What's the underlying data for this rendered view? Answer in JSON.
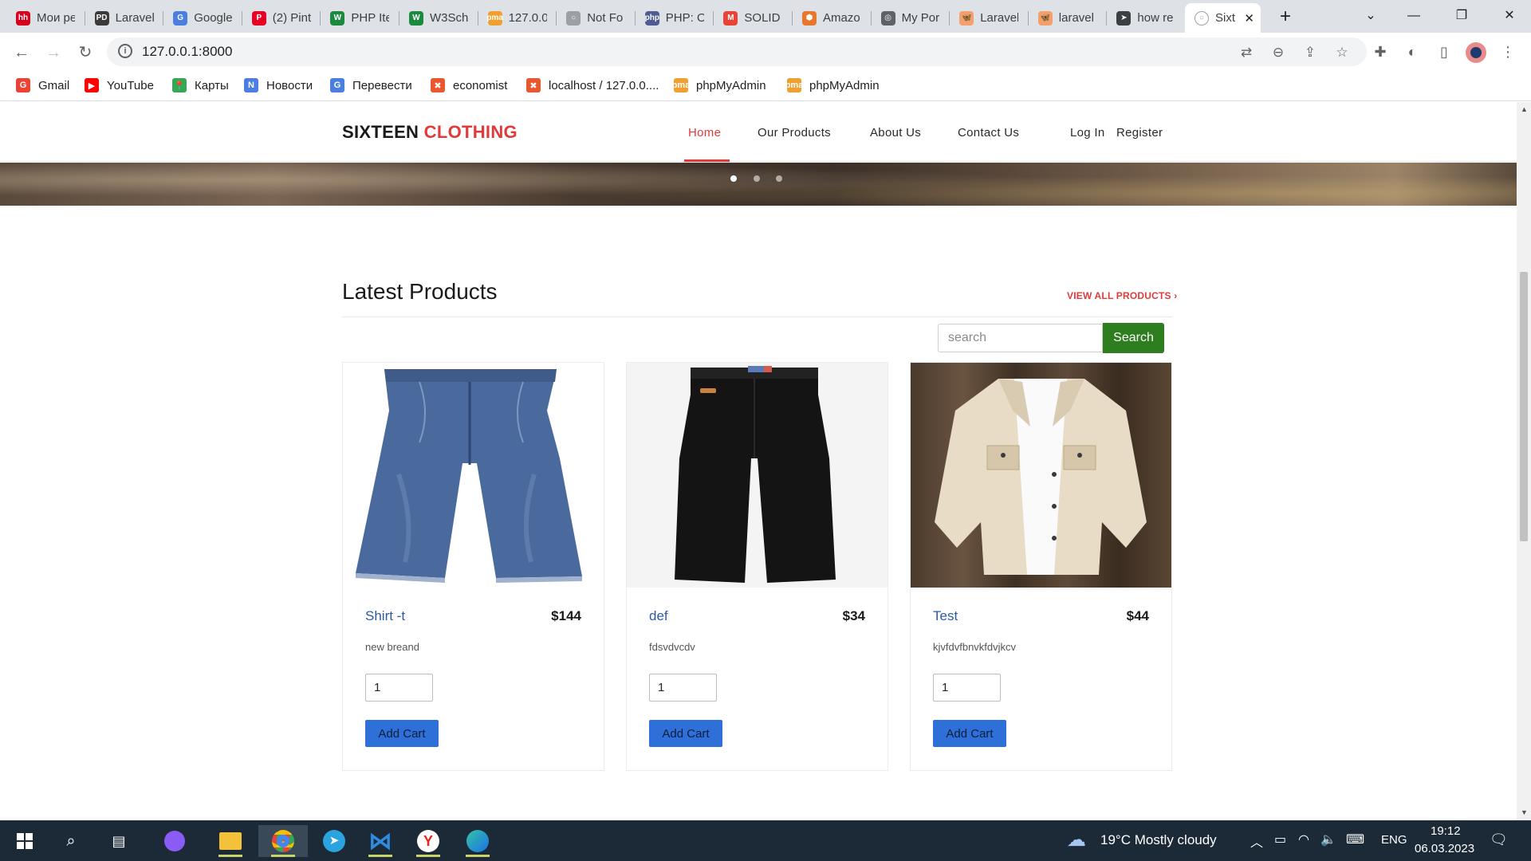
{
  "browser": {
    "tabs": [
      {
        "title": "Мои ре",
        "favicon": "hh",
        "color": "#d6001c"
      },
      {
        "title": "Laravel",
        "favicon": "PD",
        "color": "#3b3b3b"
      },
      {
        "title": "Google",
        "favicon": "G",
        "color": "#4a7fe0"
      },
      {
        "title": "(2) Pint",
        "favicon": "P",
        "color": "#e60023"
      },
      {
        "title": "PHP Ite",
        "favicon": "W",
        "color": "#1b8a3e"
      },
      {
        "title": "W3Sch",
        "favicon": "W",
        "color": "#1b8a3e"
      },
      {
        "title": "127.0.0",
        "favicon": "pma",
        "color": "#f0a030"
      },
      {
        "title": "Not Fo",
        "favicon": "○",
        "color": "#9aa0a6"
      },
      {
        "title": "PHP: O",
        "favicon": "php",
        "color": "#4f5b93"
      },
      {
        "title": "SOLID",
        "favicon": "M",
        "color": "#ea4335"
      },
      {
        "title": "Amazo",
        "favicon": "⬢",
        "color": "#e8772e"
      },
      {
        "title": "My Por",
        "favicon": "◎",
        "color": "#5f6368"
      },
      {
        "title": "Laravel",
        "favicon": "🦋",
        "color": "#f5a06a"
      },
      {
        "title": "laravel",
        "favicon": "🦋",
        "color": "#f5a06a"
      },
      {
        "title": "how re",
        "favicon": "➤",
        "color": "#3c4043"
      }
    ],
    "active_tab": {
      "title": "Sixt",
      "favicon": "○"
    },
    "url": "127.0.0.1:8000",
    "bookmarks": [
      {
        "label": "Gmail",
        "icon": "G",
        "color": "#ea4335"
      },
      {
        "label": "YouTube",
        "icon": "▶",
        "color": "#ff0000"
      },
      {
        "label": "Карты",
        "icon": "📍",
        "color": "#34a853"
      },
      {
        "label": "Новости",
        "icon": "N",
        "color": "#4a7fe0"
      },
      {
        "label": "Перевести",
        "icon": "G",
        "color": "#4a7fe0"
      },
      {
        "label": "economist",
        "icon": "✖",
        "color": "#e8572e"
      },
      {
        "label": "localhost / 127.0.0....",
        "icon": "✖",
        "color": "#e8572e"
      },
      {
        "label": "phpMyAdmin",
        "icon": "pma",
        "color": "#f0a030"
      },
      {
        "label": "phpMyAdmin",
        "icon": "pma",
        "color": "#f0a030"
      }
    ]
  },
  "site": {
    "logo_part1": "SIXTEEN",
    "logo_part2": "CLOTHING",
    "nav": [
      "Home",
      "Our Products",
      "About Us",
      "Contact Us"
    ],
    "auth": [
      "Log In",
      "Register"
    ],
    "carousel_active_index": 0,
    "section_title": "Latest Products",
    "view_all": "VIEW ALL PRODUCTS ›",
    "search": {
      "placeholder": "search",
      "button": "Search"
    },
    "products": [
      {
        "name": "Shirt -t",
        "price": "$144",
        "description": "new breand",
        "qty": "1",
        "button": "Add Cart",
        "image": "blue-denim-shorts"
      },
      {
        "name": "def",
        "price": "$34",
        "description": "fdsvdvcdv",
        "qty": "1",
        "button": "Add Cart",
        "image": "black-pants"
      },
      {
        "name": "Test",
        "price": "$44",
        "description": "kjvfdvfbnvkfdvjkcv",
        "qty": "1",
        "button": "Add Cart",
        "image": "beige-jacket"
      }
    ],
    "colors": {
      "accent": "#e03a3a",
      "search_button": "#2e7d1f",
      "add_button": "#2f6fd8",
      "product_name": "#2c5aa0"
    }
  },
  "taskbar": {
    "weather": "19°C  Mostly cloudy",
    "language": "ENG",
    "time": "19:12",
    "date": "06.03.2023"
  }
}
